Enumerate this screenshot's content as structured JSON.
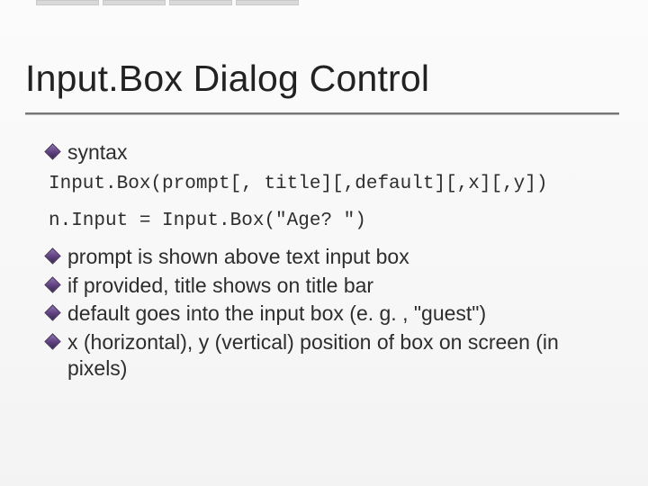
{
  "title": "Input.Box Dialog Control",
  "bullets_top": [
    "syntax"
  ],
  "code_lines": [
    "Input.Box(prompt[, title][,default][,x][,y])",
    "n.Input = Input.Box(\"Age? \")"
  ],
  "bullets_bottom": [
    "prompt is shown above text input box",
    "if provided, title shows on title bar",
    "default goes into the input box (e. g. , \"guest\")",
    "x (horizontal), y  (vertical) position of box on screen (in pixels)"
  ]
}
